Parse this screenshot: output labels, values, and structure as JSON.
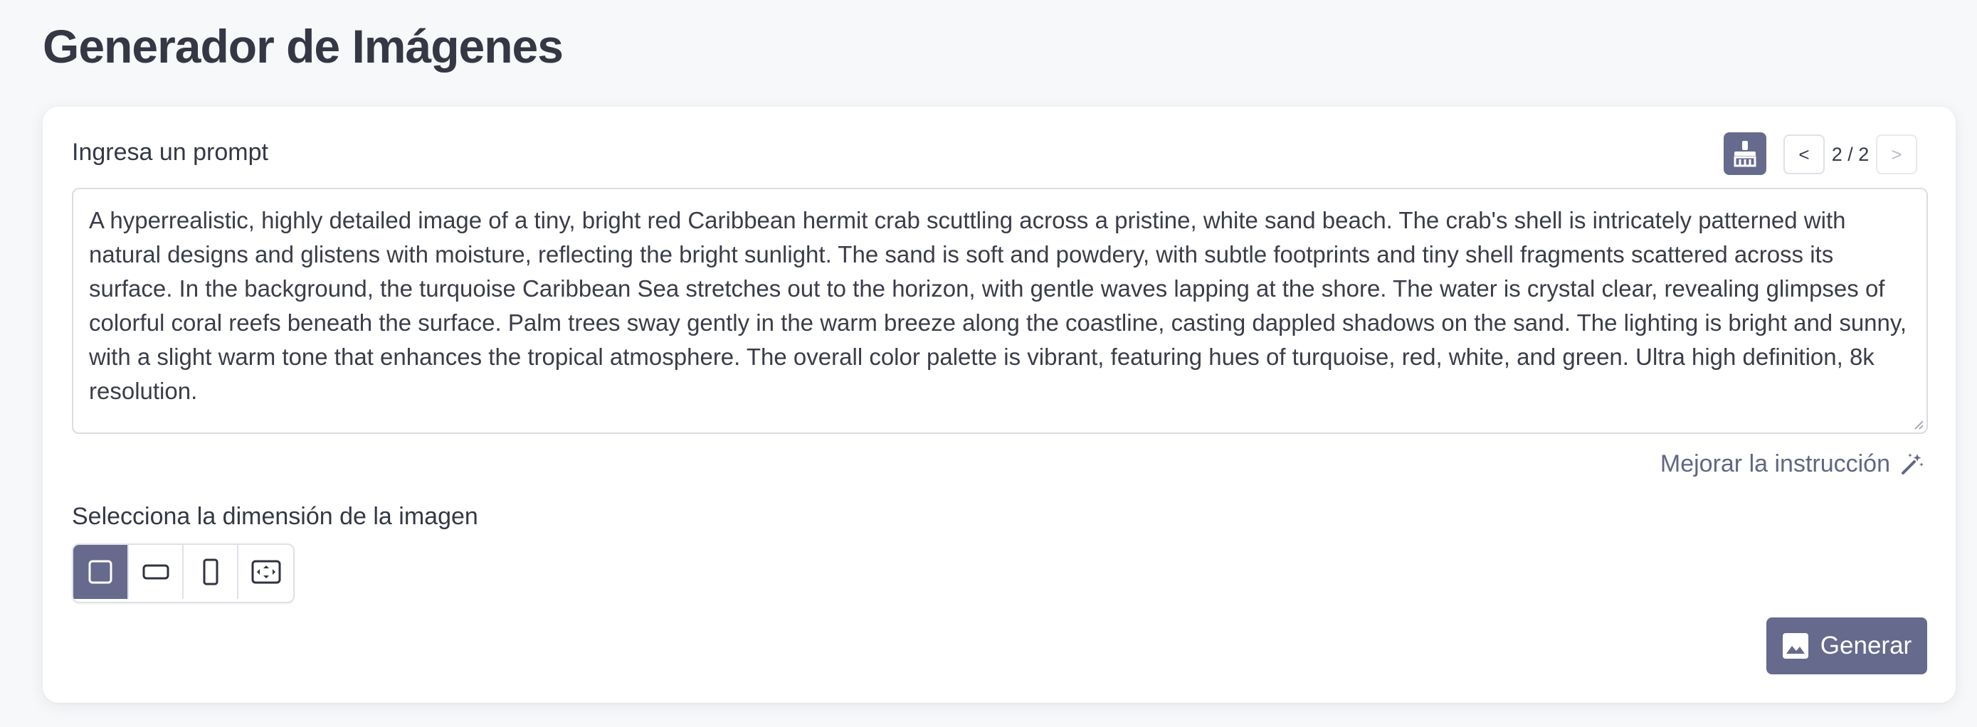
{
  "page": {
    "title": "Generador de Imágenes"
  },
  "prompt": {
    "label": "Ingresa un prompt",
    "value": "A hyperrealistic, highly detailed image of a tiny, bright red Caribbean hermit crab scuttling across a pristine, white sand beach. The crab's shell is intricately patterned with natural designs and glistens with moisture, reflecting the bright sunlight. The sand is soft and powdery, with subtle footprints and tiny shell fragments scattered across its surface. In the background, the turquoise Caribbean Sea stretches out to the horizon, with gentle waves lapping at the shore. The water is crystal clear, revealing glimpses of colorful coral reefs beneath the surface. Palm trees sway gently in the warm breeze along the coastline, casting dappled shadows on the sand. The lighting is bright and sunny, with a slight warm tone that enhances the tropical atmosphere. The overall color palette is vibrant, featuring hues of turquoise, red, white, and green. Ultra high definition, 8k resolution.",
    "clear_icon": "broom-icon"
  },
  "pager": {
    "prev_label": "<",
    "next_label": ">",
    "count": "2 / 2",
    "next_disabled": true
  },
  "improve": {
    "label": "Mejorar la instrucción",
    "icon": "magic-wand-icon"
  },
  "dimension": {
    "label": "Selecciona la dimensión de la imagen",
    "options": [
      {
        "name": "square",
        "icon": "square-icon",
        "selected": true
      },
      {
        "name": "landscape",
        "icon": "landscape-rect-icon",
        "selected": false
      },
      {
        "name": "portrait",
        "icon": "portrait-rect-icon",
        "selected": false
      },
      {
        "name": "custom",
        "icon": "custom-size-icon",
        "selected": false
      }
    ]
  },
  "generate": {
    "label": "Generar",
    "icon": "image-icon"
  },
  "colors": {
    "accent": "#666a8c",
    "border": "#dfe1e8",
    "text": "#343846",
    "background": "#f7f8fa"
  }
}
